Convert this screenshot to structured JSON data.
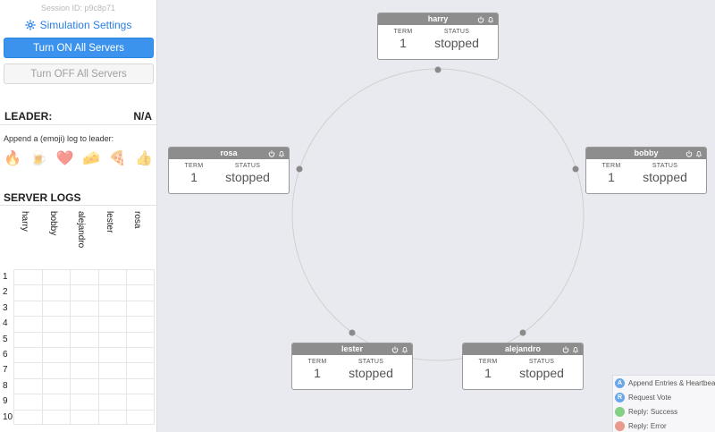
{
  "session": {
    "label": "Session ID: p9c8p71"
  },
  "settings": {
    "label": "Simulation Settings",
    "icon": "gear-icon"
  },
  "buttons": {
    "turn_on": "Turn ON All Servers",
    "turn_off": "Turn OFF All Servers"
  },
  "leader": {
    "label": "LEADER:",
    "value": "N/A"
  },
  "append": {
    "label": "Append a (emoji) log to leader:",
    "emojis": [
      "🔥",
      "🍺",
      "❤️",
      "🧀",
      "🍕",
      "👍"
    ]
  },
  "logs": {
    "title": "SERVER LOGS",
    "columns": [
      "harry",
      "bobby",
      "alejandro",
      "lester",
      "rosa"
    ],
    "rows": [
      "1",
      "2",
      "3",
      "4",
      "5",
      "6",
      "7",
      "8",
      "9",
      "10"
    ]
  },
  "servers": [
    {
      "name": "harry",
      "term_label": "TERM",
      "term": "1",
      "status_label": "STATUS",
      "status": "stopped"
    },
    {
      "name": "bobby",
      "term_label": "TERM",
      "term": "1",
      "status_label": "STATUS",
      "status": "stopped"
    },
    {
      "name": "alejandro",
      "term_label": "TERM",
      "term": "1",
      "status_label": "STATUS",
      "status": "stopped"
    },
    {
      "name": "lester",
      "term_label": "TERM",
      "term": "1",
      "status_label": "STATUS",
      "status": "stopped"
    },
    {
      "name": "rosa",
      "term_label": "TERM",
      "term": "1",
      "status_label": "STATUS",
      "status": "stopped"
    }
  ],
  "legend": [
    {
      "letter": "A",
      "label": "Append Entries & Heartbeat",
      "color": "#6aa7e8"
    },
    {
      "letter": "R",
      "label": "Request Vote",
      "color": "#6aa7e8"
    },
    {
      "letter": "",
      "label": "Reply: Success",
      "color": "#86cf86"
    },
    {
      "letter": "",
      "label": "Reply: Error",
      "color": "#e89a8c"
    }
  ],
  "colors": {
    "accent": "#3b93ee",
    "header": "#8d8d8d",
    "canvas": "#e9eaf0"
  }
}
